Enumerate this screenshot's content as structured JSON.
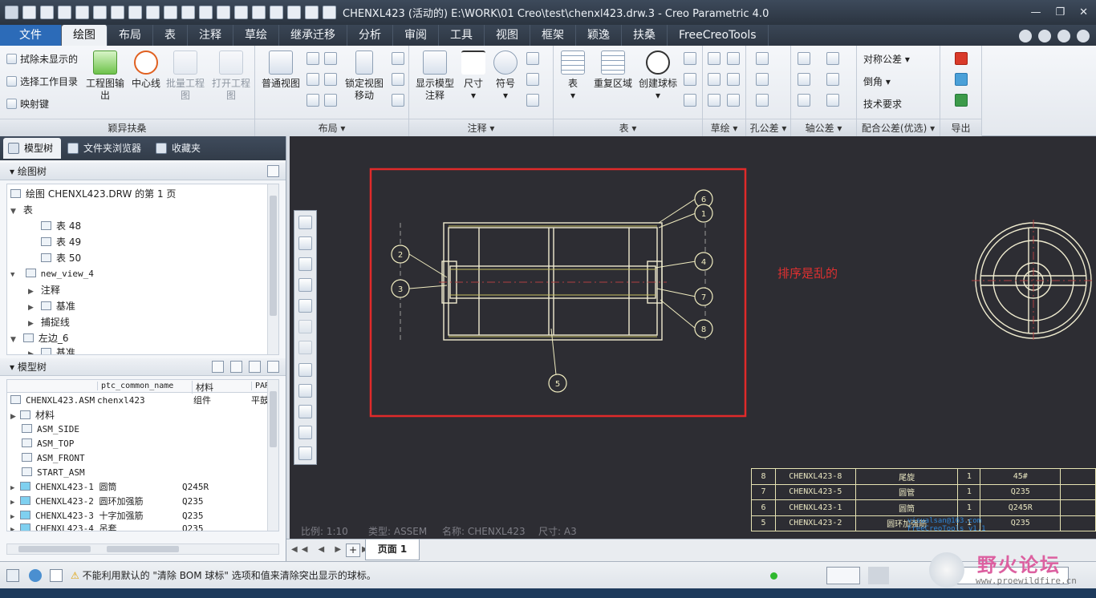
{
  "window": {
    "title": "CHENXL423 (活动的) E:\\WORK\\01 Creo\\test\\chenxl423.drw.3 - Creo Parametric 4.0",
    "min_glyph": "—",
    "max_glyph": "❐",
    "close_glyph": "✕"
  },
  "tabs": [
    "文件",
    "绘图",
    "布局",
    "表",
    "注释",
    "草绘",
    "继承迁移",
    "分析",
    "审阅",
    "工具",
    "视图",
    "框架",
    "颖逸",
    "扶桑",
    "FreeCreoTools"
  ],
  "ribbon": {
    "g1": {
      "label": "颖异扶桑",
      "items": [
        "拭除未显示的",
        "选择工作目录",
        "映射键"
      ],
      "big": [
        "工程图输出",
        "中心线",
        "批量工程图",
        "打开工程图"
      ]
    },
    "g2": {
      "label": "布局",
      "big": [
        "普通视图",
        "锁定视图移动"
      ]
    },
    "g3": {
      "label": "注释",
      "big": [
        "显示模型注释",
        "尺寸",
        "符号"
      ]
    },
    "g4": {
      "label": "表",
      "big": [
        "表",
        "重复区域",
        "创建球标"
      ]
    },
    "g5": {
      "label": "草绘"
    },
    "g6": {
      "label": "孔公差"
    },
    "g7": {
      "label": "轴公差"
    },
    "g8": {
      "label": "配合公差(优选)",
      "items": [
        "对称公差",
        "倒角",
        "技术要求"
      ]
    },
    "g9": {
      "label": "导出"
    }
  },
  "leftpane": {
    "tabs": [
      "模型树",
      "文件夹浏览器",
      "收藏夹"
    ],
    "drawing_tree": {
      "header": "绘图树",
      "items": [
        "绘图 CHENXL423.DRW 的第 1 页",
        "表",
        "表 48",
        "表 49",
        "表 50",
        "new_view_4",
        "注释",
        "基准",
        "捕捉线",
        "左边_6",
        "基准"
      ]
    },
    "model_tree": {
      "header": "模型树",
      "columns": [
        "",
        "ptc_common_name",
        "材料",
        "PART_N"
      ],
      "root": {
        "name": "CHENXL423.ASM",
        "common": "chenxl423",
        "material": "组件",
        "part": "平鼓"
      },
      "rows": [
        {
          "name": "材料",
          "material": ""
        },
        {
          "name": "ASM_SIDE",
          "material": ""
        },
        {
          "name": "ASM_TOP",
          "material": ""
        },
        {
          "name": "ASM_FRONT",
          "material": ""
        },
        {
          "name": "START_ASM",
          "material": ""
        },
        {
          "name": "CHENXL423-1 圆筒",
          "material": "Q245R"
        },
        {
          "name": "CHENXL423-2 圆环加强筋",
          "material": "Q235"
        },
        {
          "name": "CHENXL423-3 十字加强筋",
          "material": "Q235"
        },
        {
          "name": "CHENXL423-4 吊套",
          "material": "Q235"
        }
      ]
    }
  },
  "drawing": {
    "annotation": "排序是乱的",
    "balloons": [
      "6",
      "1",
      "2",
      "3",
      "4",
      "7",
      "8",
      "5"
    ],
    "info": {
      "scale": "比例: 1:10",
      "type": "类型: ASSEM",
      "name": "名称: CHENXL423",
      "size": "尺寸: A3"
    },
    "watermark": "visualsan@163.com FreeCreoTools v1.1",
    "bom": [
      {
        "idx": "8",
        "code": "CHENXL423-8",
        "name": "尾旋",
        "qty": "1",
        "mat": "45#"
      },
      {
        "idx": "7",
        "code": "CHENXL423-5",
        "name": "圆管",
        "qty": "1",
        "mat": "Q235"
      },
      {
        "idx": "6",
        "code": "CHENXL423-1",
        "name": "圆筒",
        "qty": "1",
        "mat": "Q245R"
      },
      {
        "idx": "5",
        "code": "CHENXL423-2",
        "name": "圆环加强筋",
        "qty": "1",
        "mat": "Q235"
      }
    ]
  },
  "sheetbar": {
    "page": "页面 1",
    "add": "+"
  },
  "status": {
    "message": "不能利用默认的 \"清除 BOM 球标\" 选项和值来清除突出显示的球标。"
  },
  "logo": {
    "cn": "野火论坛",
    "url": "www.proewildfire.cn"
  },
  "colors": {
    "annotation_red": "#e03030",
    "frame_red": "#e02a2a",
    "line": "#f0ecd0",
    "balloon": "#f0ecc0"
  }
}
